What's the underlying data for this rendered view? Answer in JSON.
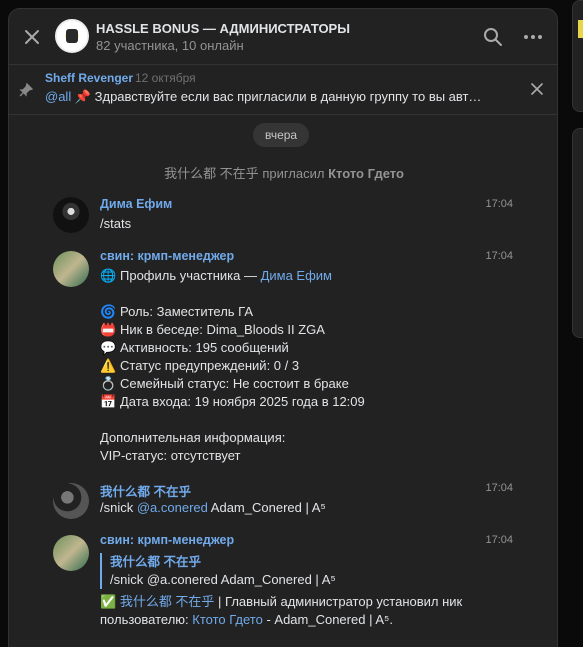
{
  "header": {
    "title": "HASSLE BONUS — АДМИНИСТРАТОРЫ",
    "subtitle": "82 участника, 10 онлайн"
  },
  "pinned": {
    "author": "Sheff Revenger",
    "date": "12 октября",
    "mention": "@all",
    "emoji": "📌",
    "text": "Здравствуйте если вас пригласили в данную группу то вы автомат..."
  },
  "date_divider": "вчера",
  "service": {
    "actor": "我什么都 不在乎",
    "action": "пригласил",
    "target": "Ктото Гдето"
  },
  "messages": [
    {
      "author": "Дима Ефим",
      "time": "17:04",
      "text": "/stats"
    },
    {
      "author": "свин: крмп-менеджер",
      "time": "17:04",
      "profile_line": "Профиль участника — ",
      "profile_name": "Дима Ефим",
      "lines": [
        {
          "emoji": "🌀",
          "text": "Роль: Заместитель ГА"
        },
        {
          "emoji": "📛",
          "text": "Ник в беседе: Dima_Bloods II ZGA"
        },
        {
          "emoji": "💬",
          "text": "Активность: 195 сообщений"
        },
        {
          "emoji": "⚠️",
          "text": "Статус предупреждений: 0 / 3"
        },
        {
          "emoji": "💍",
          "text": "Семейный статус: Не состоит в браке"
        },
        {
          "emoji": "📅",
          "text": "Дата входа: 19 ноября 2025 года в 12:09"
        }
      ],
      "extra_title": "Дополнительная информация:",
      "extra_vip": "VIP-статус: отсутствует"
    },
    {
      "author": "我什么都 不在乎",
      "time": "17:04",
      "cmd": "/snick",
      "mention": "@a.conered",
      "rest": "Adam_Conered | A⁵"
    },
    {
      "author": "свин: крмп-менеджер",
      "time": "17:04",
      "quote_author": "我什么都 不在乎",
      "quote_text": "/snick @a.conered Adam_Conered | A⁵",
      "check": "✅",
      "actor": "我什么都 不在乎",
      "mid": " | Главный администратор установил ник пользователю: ",
      "target": "Ктото Гдето",
      "tail": " - Adam_Conered | A⁵."
    }
  ],
  "colors": {
    "accent": "#71aaeb",
    "background": "#222222"
  }
}
